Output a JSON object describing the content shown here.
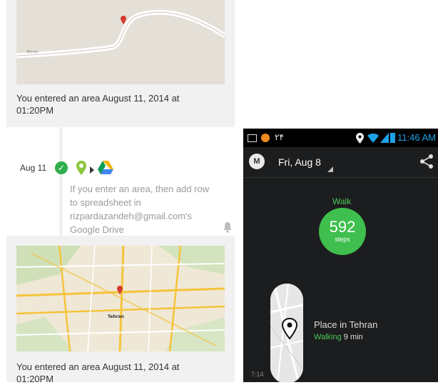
{
  "feed": {
    "entries": [
      {
        "caption": "You entered an area August 11, 2014 at 01:20PM"
      },
      {
        "caption": "You entered an area August 11, 2014 at 01:20PM"
      }
    ],
    "event": {
      "date": "Aug 11",
      "recipe_text": "If you enter an area, then add row to spreadsheet in rizpardazandeh@gmail.com's Google Drive"
    },
    "map_labels": [
      "Tehran"
    ]
  },
  "phone": {
    "status": {
      "notification_number": "۲۴",
      "time": "11:46 AM"
    },
    "header": {
      "date": "Fri, Aug 8"
    },
    "activity": {
      "label": "Walk",
      "steps": "592",
      "steps_unit": "steps"
    },
    "place": {
      "title": "Place in Tehran",
      "activity": "Walking",
      "duration": "9 min"
    },
    "timeline_time": "7:14"
  },
  "colors": {
    "moves_green": "#3fbf4d",
    "check_green": "#2fae4b",
    "status_blue": "#1fa3e8",
    "phone_background": "#1c1d1e"
  },
  "icons": [
    "check-icon",
    "location-pin-icon",
    "arrow-right-icon",
    "google-drive-icon",
    "bell-icon",
    "moves-logo-icon",
    "share-icon",
    "wifi-icon",
    "battery-icon",
    "map-pin-icon"
  ]
}
